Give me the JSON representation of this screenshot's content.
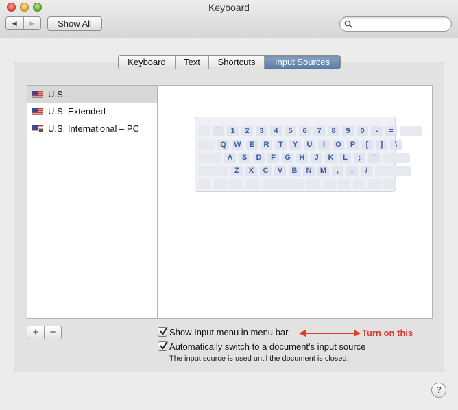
{
  "window": {
    "title": "Keyboard"
  },
  "toolbar": {
    "back_glyph": "◀",
    "forward_glyph": "▶",
    "show_all_label": "Show All",
    "search_placeholder": "",
    "search_icon": "search-icon"
  },
  "tabs": [
    {
      "label": "Keyboard",
      "active": false
    },
    {
      "label": "Text",
      "active": false
    },
    {
      "label": "Shortcuts",
      "active": false
    },
    {
      "label": "Input Sources",
      "active": true
    }
  ],
  "input_sources": [
    {
      "label": "U.S.",
      "selected": true,
      "icon": "us-flag-icon"
    },
    {
      "label": "U.S. Extended",
      "selected": false,
      "icon": "us-flag-icon"
    },
    {
      "label": "U.S. International – PC",
      "selected": false,
      "icon": "us-intl-flag-icon"
    }
  ],
  "keyboard": {
    "rows": [
      [
        "",
        "`",
        "1",
        "2",
        "3",
        "4",
        "5",
        "6",
        "7",
        "8",
        "9",
        "0",
        "-",
        "=",
        ""
      ],
      [
        "",
        "Q",
        "W",
        "E",
        "R",
        "T",
        "Y",
        "U",
        "I",
        "O",
        "P",
        "[",
        "]",
        "\\"
      ],
      [
        "",
        "A",
        "S",
        "D",
        "F",
        "G",
        "H",
        "J",
        "K",
        "L",
        ";",
        "'",
        ""
      ],
      [
        "",
        "Z",
        "X",
        "C",
        "V",
        "B",
        "N",
        "M",
        ",",
        ".",
        "/",
        ""
      ],
      [
        "",
        "",
        "",
        "",
        "",
        "",
        "",
        "",
        "",
        "",
        ""
      ]
    ]
  },
  "list_buttons": {
    "add_label": "+",
    "remove_label": "−"
  },
  "options": {
    "show_input_menu": {
      "label": "Show Input menu in menu bar",
      "checked": true
    },
    "auto_switch": {
      "label": "Automatically switch to a document's input source",
      "checked": true
    },
    "note": "The input source is used until the document is closed."
  },
  "annotation": {
    "text": "Turn on this",
    "color": "#e03b2e"
  },
  "help": {
    "label": "?"
  }
}
